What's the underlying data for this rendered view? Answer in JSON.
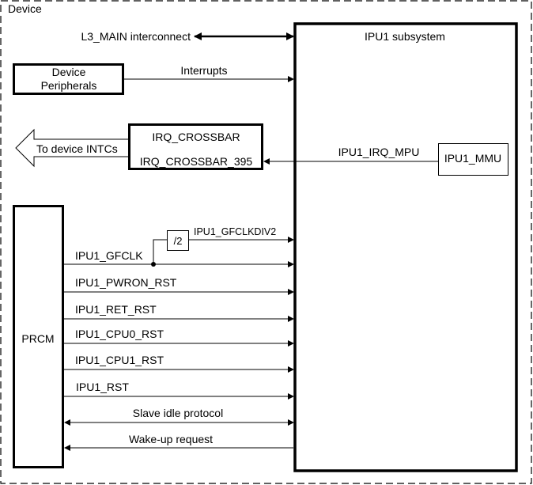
{
  "diagram": {
    "container_label": "Device",
    "blocks": {
      "ipu1_subsystem": "IPU1 subsystem",
      "device_peripherals_line1": "Device",
      "device_peripherals_line2": "Peripherals",
      "irq_crossbar_title": "IRQ_CROSSBAR",
      "irq_crossbar_port": "IRQ_CROSSBAR_395",
      "ipu1_mmu": "IPU1_MMU",
      "prcm": "PRCM",
      "divider": "/2"
    },
    "signals": {
      "l3_main": "L3_MAIN interconnect",
      "interrupts": "Interrupts",
      "to_device_intcs": "To device INTCs",
      "ipu1_irq_mpu": "IPU1_IRQ_MPU",
      "ipu1_gfclkdiv2": "IPU1_GFCLKDIV2",
      "ipu1_gfclk": "IPU1_GFCLK",
      "ipu1_pwron_rst": "IPU1_PWRON_RST",
      "ipu1_ret_rst": "IPU1_RET_RST",
      "ipu1_cpu0_rst": "IPU1_CPU0_RST",
      "ipu1_cpu1_rst": "IPU1_CPU1_RST",
      "ipu1_rst": "IPU1_RST",
      "slave_idle": "Slave idle protocol",
      "wakeup": "Wake-up request"
    }
  }
}
